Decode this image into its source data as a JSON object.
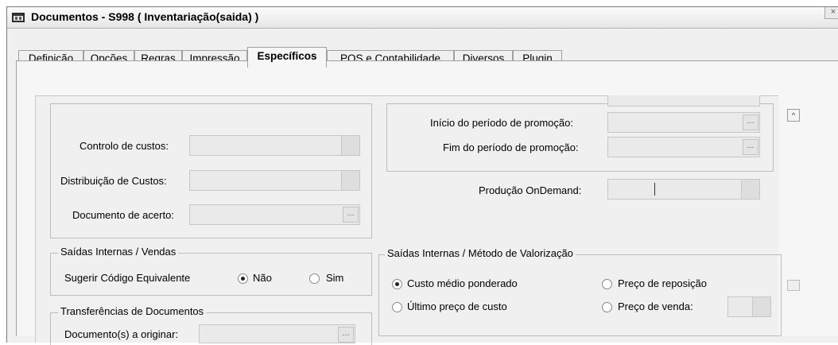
{
  "window": {
    "title": "Documentos - S998 ( Inventariação(saida) )",
    "close_glyph": "×"
  },
  "tabs": [
    {
      "label": "Definição",
      "active": false
    },
    {
      "label": "Opções",
      "active": false
    },
    {
      "label": "Regras",
      "active": false
    },
    {
      "label": "Impressão",
      "active": false
    },
    {
      "label": "Específicos",
      "active": true
    },
    {
      "label": "POS e Contabilidade",
      "active": false
    },
    {
      "label": "Diversos",
      "active": false
    },
    {
      "label": "Plugin",
      "active": false
    }
  ],
  "left": {
    "controlo_custos_label": "Controlo de custos:",
    "distribuicao_custos_label": "Distribuição de Custos:",
    "documento_acerto_label": "Documento de acerto:",
    "dots_glyph": "..."
  },
  "promo": {
    "inicio_label": "Início do período de promoção:",
    "fim_label": "Fim do período de promoção:"
  },
  "producao": {
    "label": "Produção OnDemand:"
  },
  "saidas_vendas": {
    "legend": "Saídas Internas / Vendas",
    "sugerir_label": "Sugerir Código Equivalente",
    "nao_label": "Não",
    "sim_label": "Sim",
    "selected": "Não"
  },
  "transferencias": {
    "legend": "Transferências de Documentos",
    "documentos_label": "Documento(s) a originar:"
  },
  "valorizacao": {
    "legend": "Saídas Internas / Método de  Valorização",
    "options": [
      {
        "label": "Custo médio ponderado",
        "checked": true
      },
      {
        "label": "Preço de reposição",
        "checked": false
      },
      {
        "label": "Último preço de custo",
        "checked": false
      },
      {
        "label": "Preço de venda:",
        "checked": false
      }
    ]
  },
  "scrollbar": {
    "up_glyph": "^"
  },
  "colors": {
    "tab_page": "#f6f6f6",
    "panel": "#f0f0f0",
    "field": "#eaeaea"
  }
}
